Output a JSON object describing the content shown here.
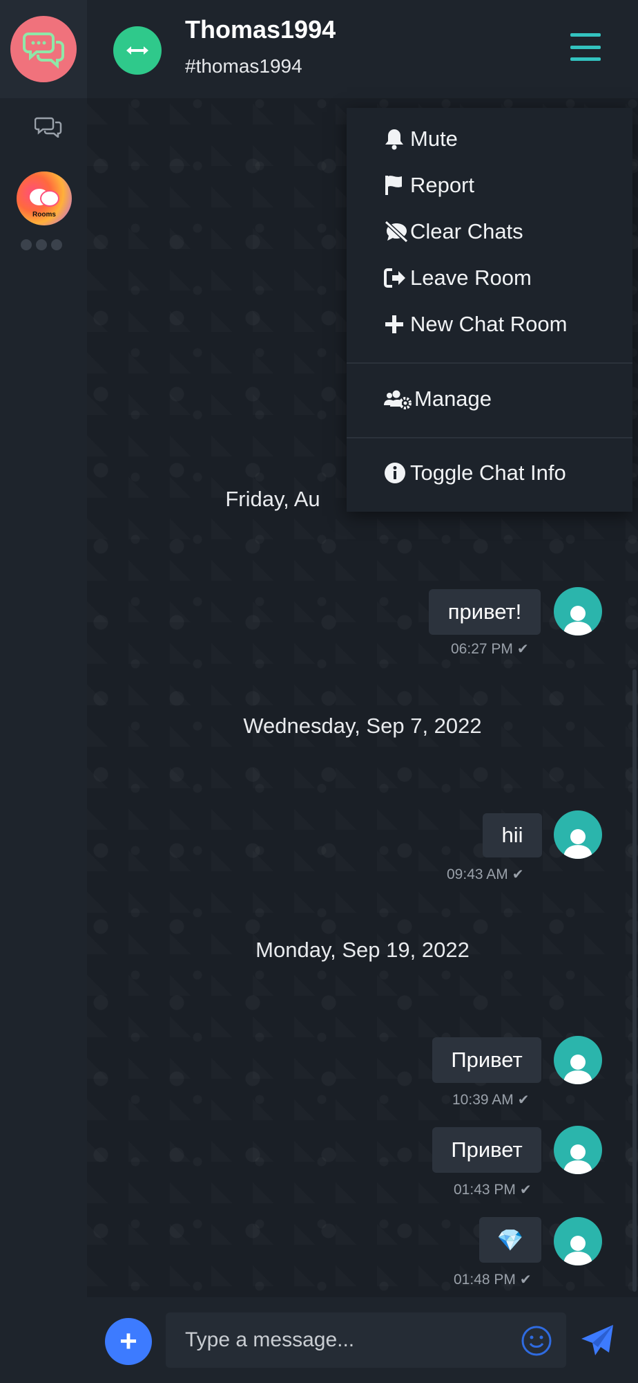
{
  "colors": {
    "accent_teal": "#33c3c0",
    "room_avatar_green": "#2fc98b",
    "logo_pink": "#f0727c",
    "user_avatar_teal": "#2bb5ac",
    "add_button_blue": "#3d7bff",
    "send_blue": "#3d7bff"
  },
  "rail": {
    "logo_icon": "chat-bubbles-icon",
    "chats_icon": "chats-icon",
    "room_avatar_caption": "Rooms"
  },
  "header": {
    "name": "Thomas1994",
    "handle": "#thomas1994",
    "avatar_icon": "arrows-horizontal-icon",
    "menu_icon": "hamburger-icon"
  },
  "menu": {
    "items": [
      {
        "label": "Mute",
        "icon": "bell-icon"
      },
      {
        "label": "Report",
        "icon": "flag-icon"
      },
      {
        "label": "Clear Chats",
        "icon": "comment-slash-icon"
      },
      {
        "label": "Leave Room",
        "icon": "sign-out-icon"
      },
      {
        "label": "New Chat Room",
        "icon": "plus-icon"
      },
      {
        "label": "Manage",
        "icon": "users-cog-icon"
      },
      {
        "label": "Toggle Chat Info",
        "icon": "info-circle-icon"
      }
    ]
  },
  "messages": {
    "date_1_partial": "Friday, Au",
    "date_2": "Wednesday, Sep 7, 2022",
    "date_3": "Monday, Sep 19, 2022",
    "items": [
      {
        "text": "привет!",
        "time": "06:27 PM"
      },
      {
        "text": "hii",
        "time": "09:43 AM"
      },
      {
        "text": "Привет",
        "time": "10:39 AM"
      },
      {
        "text": "Привет",
        "time": "01:43 PM"
      },
      {
        "text": "💎",
        "time": "01:48 PM"
      }
    ]
  },
  "composer": {
    "placeholder": "Type a message...",
    "add_label": "+",
    "emoji_icon": "smile-icon",
    "send_icon": "paper-plane-icon"
  }
}
